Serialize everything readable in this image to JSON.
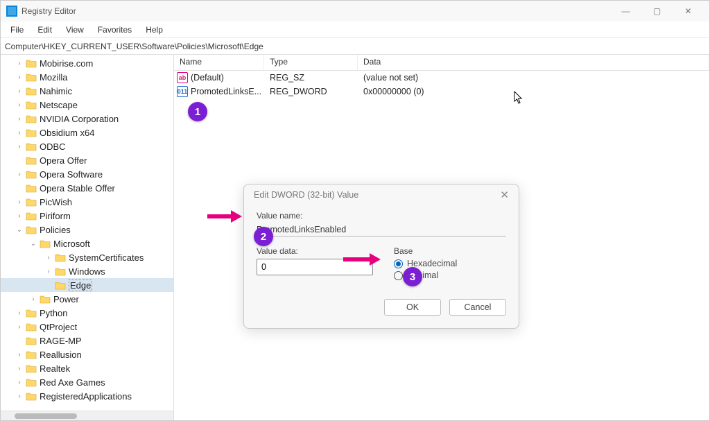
{
  "window": {
    "title": "Registry Editor",
    "controls": {
      "minimize": "—",
      "maximize": "▢",
      "close": "✕"
    }
  },
  "menubar": [
    "File",
    "Edit",
    "View",
    "Favorites",
    "Help"
  ],
  "address": "Computer\\HKEY_CURRENT_USER\\Software\\Policies\\Microsoft\\Edge",
  "tree": {
    "items": [
      {
        "label": "Mobirise.com",
        "indent": 0,
        "exp": "right"
      },
      {
        "label": "Mozilla",
        "indent": 0,
        "exp": "right"
      },
      {
        "label": "Nahimic",
        "indent": 0,
        "exp": "right"
      },
      {
        "label": "Netscape",
        "indent": 0,
        "exp": "right"
      },
      {
        "label": "NVIDIA Corporation",
        "indent": 0,
        "exp": "right"
      },
      {
        "label": "Obsidium x64",
        "indent": 0,
        "exp": "right"
      },
      {
        "label": "ODBC",
        "indent": 0,
        "exp": "right"
      },
      {
        "label": "Opera Offer",
        "indent": 0,
        "exp": "none"
      },
      {
        "label": "Opera Software",
        "indent": 0,
        "exp": "right"
      },
      {
        "label": "Opera Stable Offer",
        "indent": 0,
        "exp": "none"
      },
      {
        "label": "PicWish",
        "indent": 0,
        "exp": "right"
      },
      {
        "label": "Piriform",
        "indent": 0,
        "exp": "right"
      },
      {
        "label": "Policies",
        "indent": 0,
        "exp": "down"
      },
      {
        "label": "Microsoft",
        "indent": 1,
        "exp": "down"
      },
      {
        "label": "SystemCertificates",
        "indent": 2,
        "exp": "right"
      },
      {
        "label": "Windows",
        "indent": 2,
        "exp": "right"
      },
      {
        "label": "Edge",
        "indent": 2,
        "exp": "none",
        "selected": true
      },
      {
        "label": "Power",
        "indent": 1,
        "exp": "right"
      },
      {
        "label": "Python",
        "indent": 0,
        "exp": "right"
      },
      {
        "label": "QtProject",
        "indent": 0,
        "exp": "right"
      },
      {
        "label": "RAGE-MP",
        "indent": 0,
        "exp": "none"
      },
      {
        "label": "Reallusion",
        "indent": 0,
        "exp": "right"
      },
      {
        "label": "Realtek",
        "indent": 0,
        "exp": "right"
      },
      {
        "label": "Red Axe Games",
        "indent": 0,
        "exp": "right"
      },
      {
        "label": "RegisteredApplications",
        "indent": 0,
        "exp": "right"
      }
    ]
  },
  "list": {
    "headers": {
      "name": "Name",
      "type": "Type",
      "data": "Data"
    },
    "rows": [
      {
        "name": "(Default)",
        "type": "REG_SZ",
        "data": "(value not set)",
        "kind": "str"
      },
      {
        "name": "PromotedLinksE...",
        "type": "REG_DWORD",
        "data": "0x00000000 (0)",
        "kind": "dw"
      }
    ]
  },
  "dialog": {
    "title": "Edit DWORD (32-bit) Value",
    "value_name_label": "Value name:",
    "value_name": "PromotedLinksEnabled",
    "value_data_label": "Value data:",
    "value_data": "0",
    "base_label": "Base",
    "radio_hex": "Hexadecimal",
    "radio_dec": "Decimal",
    "ok": "OK",
    "cancel": "Cancel"
  },
  "annotations": {
    "b1": "1",
    "b2": "2",
    "b3": "3"
  }
}
